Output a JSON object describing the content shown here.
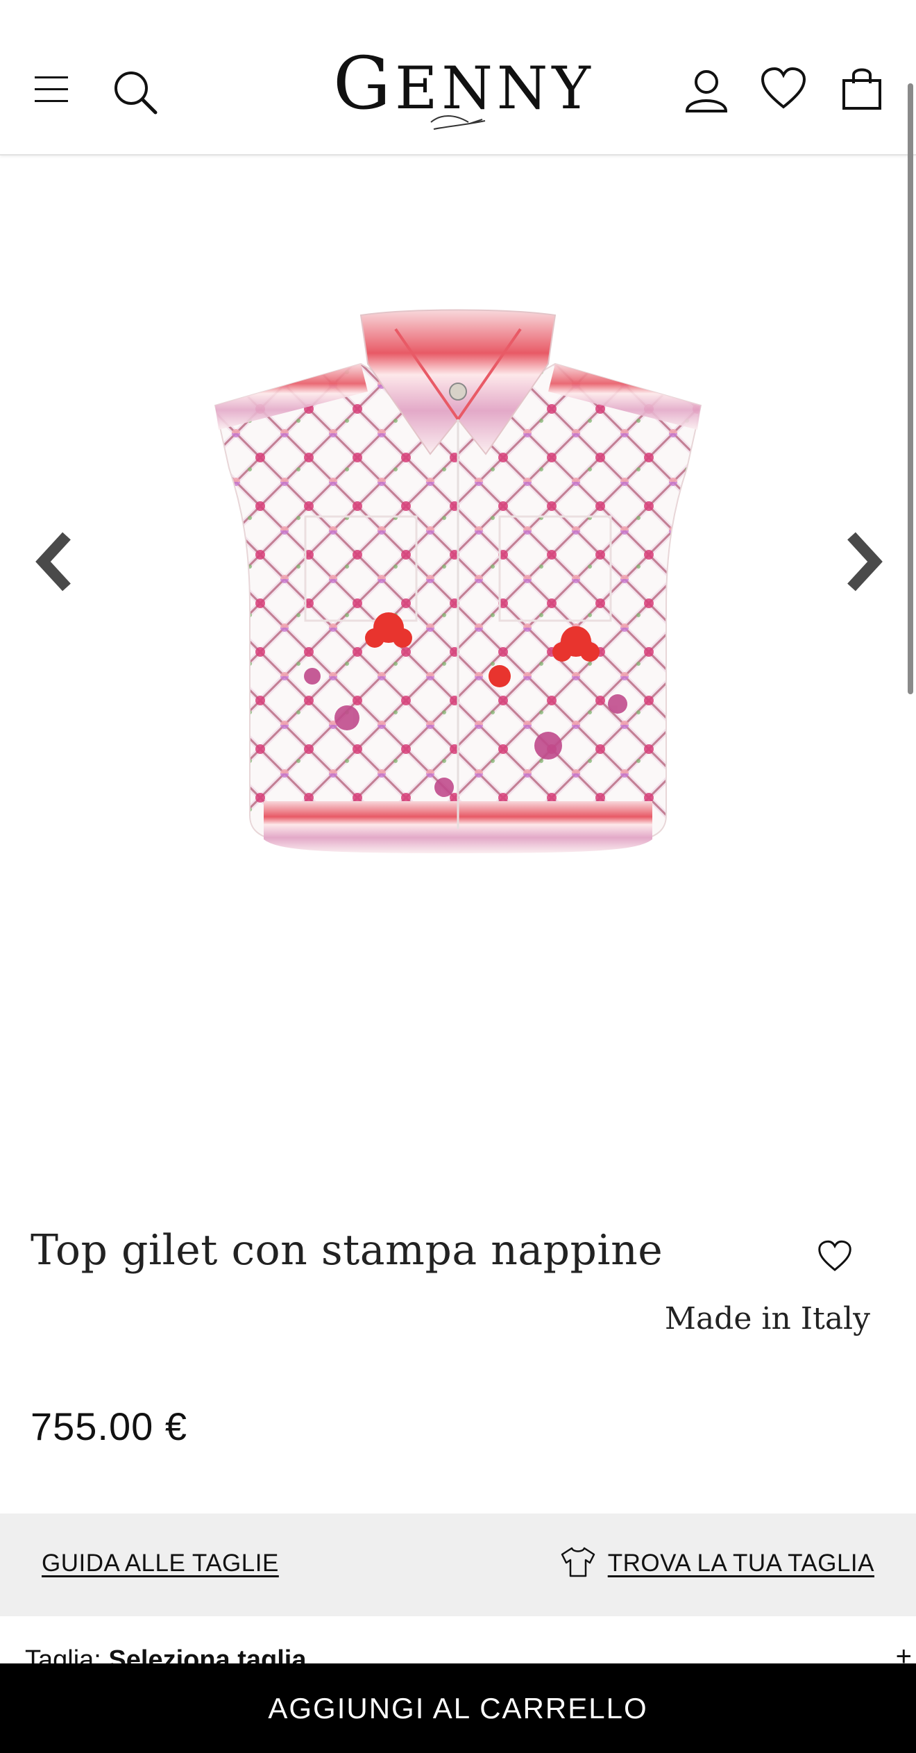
{
  "header": {
    "logo_text": "GENNY",
    "logo_initial": "G",
    "logo_rest": "ENNY"
  },
  "gallery": {
    "image_description_icon": "product-image-vest",
    "prev_icon": "chevron-left-icon",
    "next_icon": "chevron-right-icon"
  },
  "product": {
    "title": "Top gilet con stampa nappine",
    "origin": "Made in Italy",
    "price": "755.00 €"
  },
  "sizes": {
    "guide_label": "GUIDA ALLE TAGLIE",
    "find_label": "TROVA LA TUA TAGLIA",
    "size_label": "Taglia:",
    "size_value": "Seleziona taglia",
    "expand": "+"
  },
  "cart": {
    "add_label": "AGGIUNGI AL CARRELLO"
  },
  "colors": {
    "band_bg": "#efefef",
    "cart_bg": "#000000",
    "accent_red": "#e23a3a"
  }
}
